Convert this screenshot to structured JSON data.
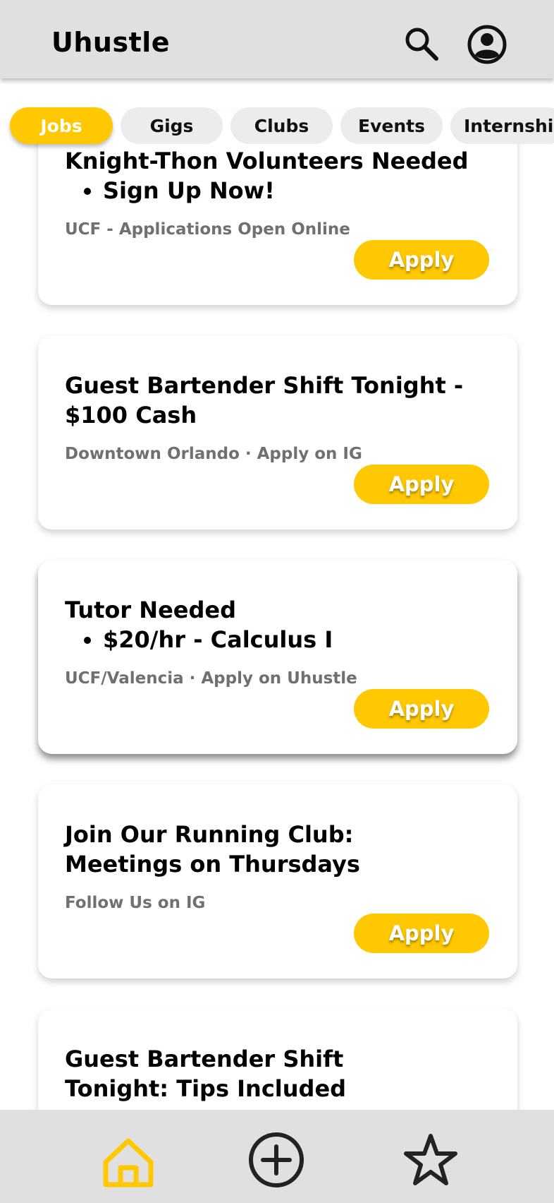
{
  "header": {
    "title": "Uhustle",
    "icons": [
      "search-icon",
      "account-circle-icon"
    ]
  },
  "tabs": [
    {
      "label": "Jobs",
      "active": true
    },
    {
      "label": "Gigs",
      "active": false
    },
    {
      "label": "Clubs",
      "active": false
    },
    {
      "label": "Events",
      "active": false
    },
    {
      "label": "Internships",
      "active": false
    }
  ],
  "cards": [
    {
      "title": "Knight-Thon Volunteers Needed",
      "bullet": "Sign Up Now!",
      "meta": "UCF -  Applications Open Online",
      "button": "Apply"
    },
    {
      "title": "Guest Bartender Shift Tonight - $100 Cash",
      "meta": "Downtown Orlando · Apply on IG",
      "button": "Apply"
    },
    {
      "title": "Tutor Needed",
      "bullet": "$20/hr - Calculus I",
      "meta": "UCF/Valencia · Apply on Uhustle",
      "button": "Apply"
    },
    {
      "title": "Join Our Running Club: Meetings on Thursdays",
      "meta": "Follow Us on IG",
      "button": "Apply"
    },
    {
      "title": "Guest Bartender Shift Tonight: Tips Included"
    }
  ],
  "bottom_nav": {
    "items": [
      "home-icon",
      "add-circle-icon",
      "star-icon"
    ],
    "active": "home-icon"
  },
  "colors": {
    "accent": "#ffc800",
    "header_bg": "#e0e0e0",
    "tab_bg": "#ececec",
    "meta_text": "#707070"
  }
}
